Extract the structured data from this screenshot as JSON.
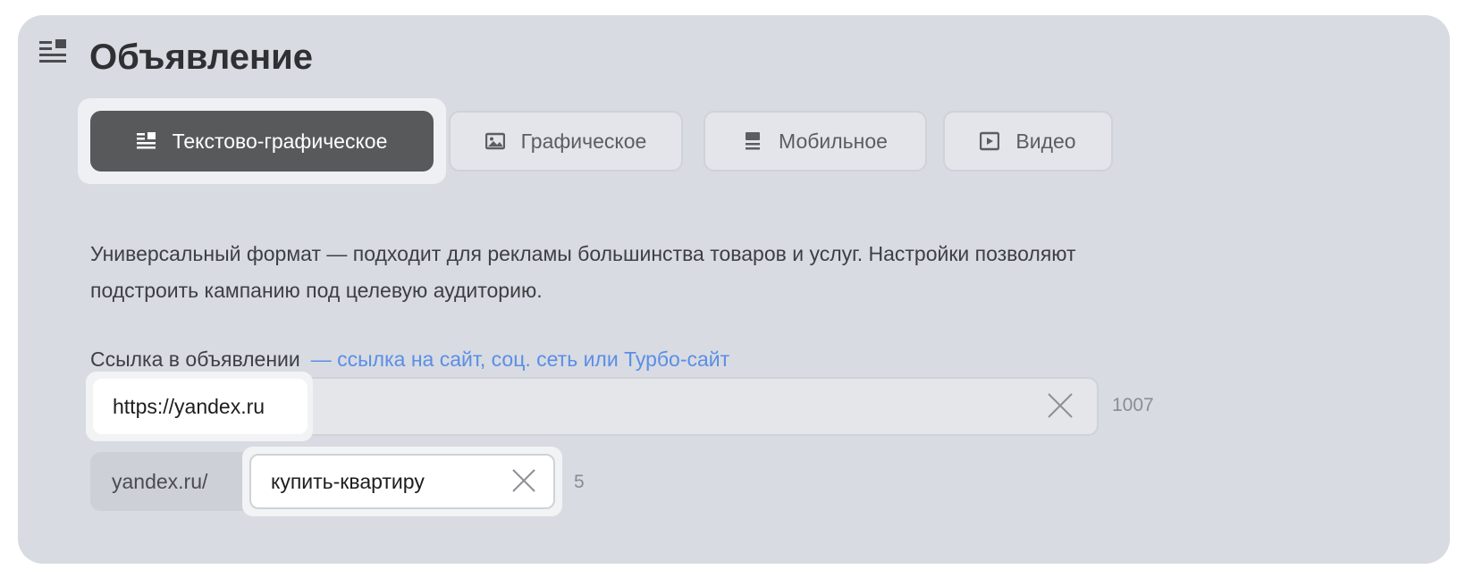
{
  "header": {
    "title": "Объявление",
    "icon": "text-graphic-ad-icon"
  },
  "tabs": [
    {
      "label": "Текстово-графическое",
      "icon": "text-graphic-icon",
      "active": true
    },
    {
      "label": "Графическое",
      "icon": "image-icon",
      "active": false
    },
    {
      "label": "Мобильное",
      "icon": "mobile-icon",
      "active": false
    },
    {
      "label": "Видео",
      "icon": "video-icon",
      "active": false
    }
  ],
  "description": "Универсальный формат — подходит для рекламы большинства товаров и услуг. Настройки позволяют подстроить кампанию под целевую аудиторию.",
  "link": {
    "label": "Ссылка в объявлении",
    "hint": "— ссылка на сайт, соц. сеть или Турбо-сайт",
    "value": "https://yandex.ru",
    "counter": "1007"
  },
  "display_link": {
    "prefix": "yandex.ru/",
    "value": "купить-квартиру",
    "counter": "5"
  },
  "colors": {
    "card_bg": "#d8dbe1",
    "active_tab": "#58595b",
    "hint_link": "#5a8ee8"
  }
}
